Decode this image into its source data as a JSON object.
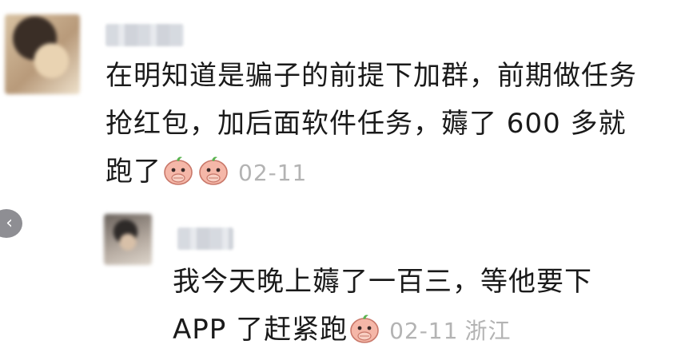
{
  "main_comment": {
    "lines": [
      "在明知道是骗子的前提下加群，前期做任务",
      "抢红包，加后面软件任务，薅了 600 多就",
      "跑了"
    ],
    "emoji": [
      "peach-cover-mouth",
      "peach-cover-mouth"
    ],
    "date": "02-11"
  },
  "reply_comment": {
    "lines": [
      "我今天晚上薅了一百三，等他要下",
      "APP 了赶紧跑"
    ],
    "emoji": [
      "peach-cover-mouth"
    ],
    "date": "02-11",
    "location": "浙江"
  },
  "collapse_button": {
    "glyph": "‹"
  }
}
